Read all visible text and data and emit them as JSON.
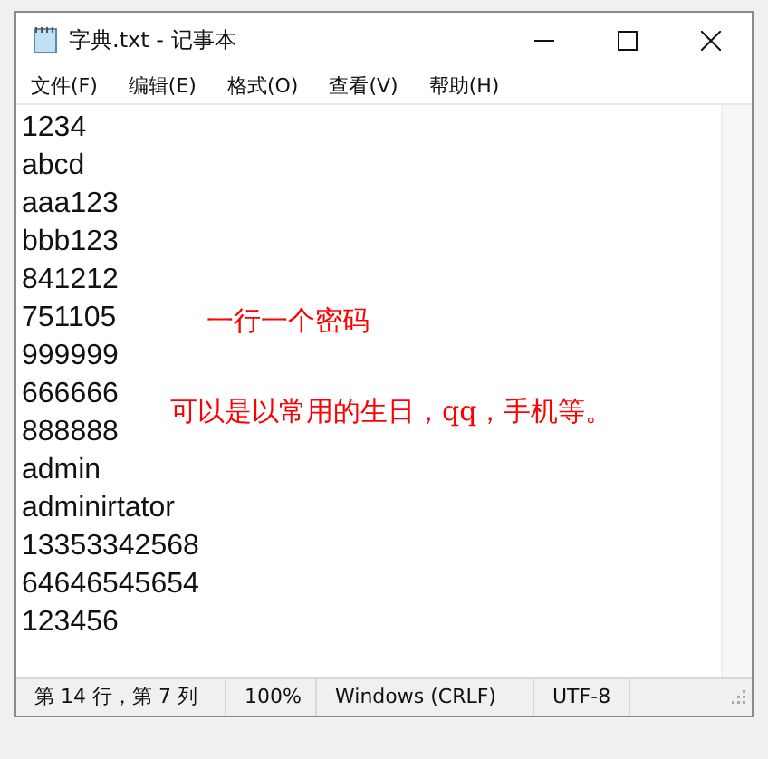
{
  "window": {
    "title": "字典.txt - 记事本"
  },
  "menu": [
    "文件(F)",
    "编辑(E)",
    "格式(O)",
    "查看(V)",
    "帮助(H)"
  ],
  "lines": [
    "1234",
    "abcd",
    "aaa123",
    "bbb123",
    "841212",
    "751105",
    "999999",
    "666666",
    "888888",
    "admin",
    "adminirtator",
    "13353342568",
    "64646545654",
    "123456"
  ],
  "annotations": [
    "一行一个密码",
    "可以是以常用的生日，qq，手机等。"
  ],
  "status_bar": [
    "第 14 行，第 7 列",
    "100%",
    "Windows (CRLF)",
    "UTF-8"
  ]
}
